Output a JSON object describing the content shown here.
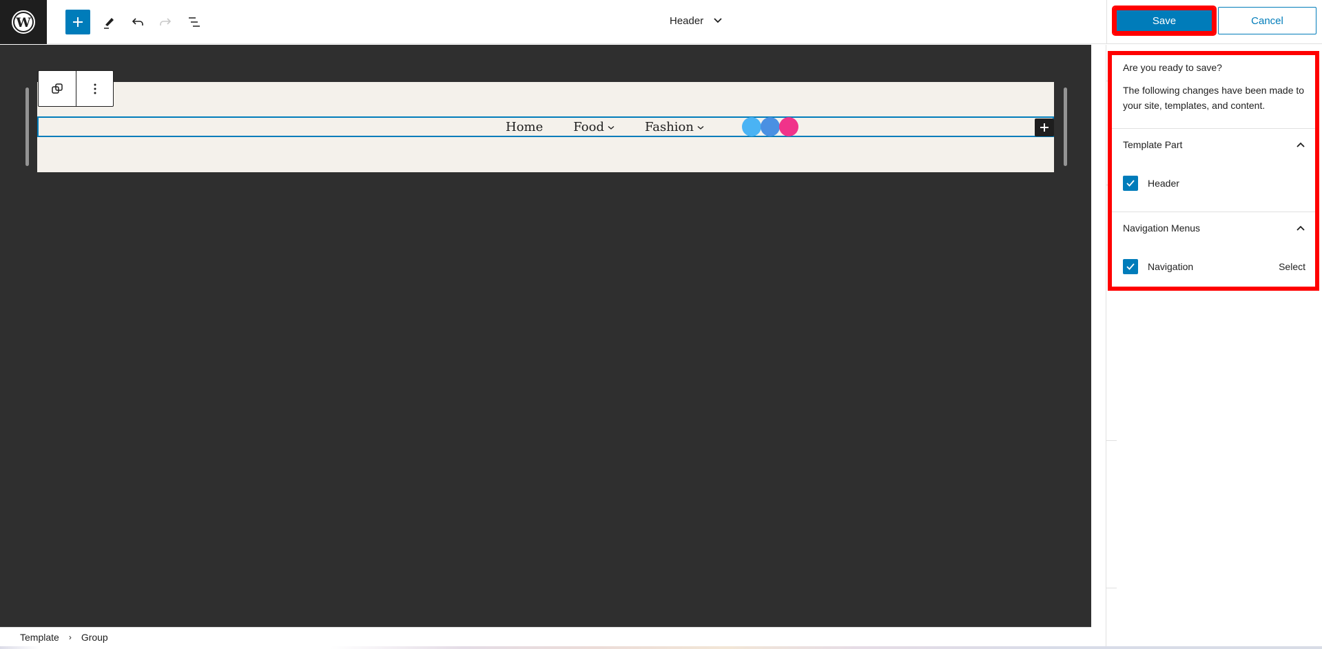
{
  "topbar": {
    "logo_icon": "wordpress-logo",
    "add_block_icon": "plus-icon",
    "tools_icon": "pencil-icon",
    "undo_icon": "undo-icon",
    "redo_icon": "redo-icon",
    "list_view_icon": "list-view-icon",
    "document_title": "Header",
    "save_label": "Save",
    "cancel_label": "Cancel"
  },
  "canvas": {
    "block_toolbar": {
      "transform_icon": "duplicate-icon",
      "options_icon": "more-vertical-icon"
    },
    "navigation": {
      "items": [
        {
          "label": "Home",
          "has_submenu": false
        },
        {
          "label": "Food",
          "has_submenu": true
        },
        {
          "label": "Fashion",
          "has_submenu": true
        }
      ],
      "social_icons": [
        {
          "name": "social-icon-1",
          "color": "#4ab3f4"
        },
        {
          "name": "social-icon-2",
          "color": "#4a90e2"
        },
        {
          "name": "social-icon-3",
          "color": "#f0338a"
        }
      ],
      "submenu_chevron": "⌄"
    },
    "inline_add_icon": "plus-icon"
  },
  "breadcrumb": {
    "items": [
      "Template",
      "Group"
    ],
    "separator": "›"
  },
  "save_panel": {
    "title": "Are you ready to save?",
    "description": "The following changes have been made to your site, templates, and content.",
    "sections": [
      {
        "title": "Template Part",
        "expanded": true,
        "items": [
          {
            "label": "Header",
            "checked": true
          }
        ]
      },
      {
        "title": "Navigation Menus",
        "expanded": true,
        "items": [
          {
            "label": "Navigation",
            "checked": true,
            "action": "Select"
          }
        ]
      }
    ]
  },
  "colors": {
    "accent": "#007cba",
    "highlight": "#ff0000",
    "canvas_bg": "#2f2f2f",
    "header_bg": "#f4f1eb"
  }
}
